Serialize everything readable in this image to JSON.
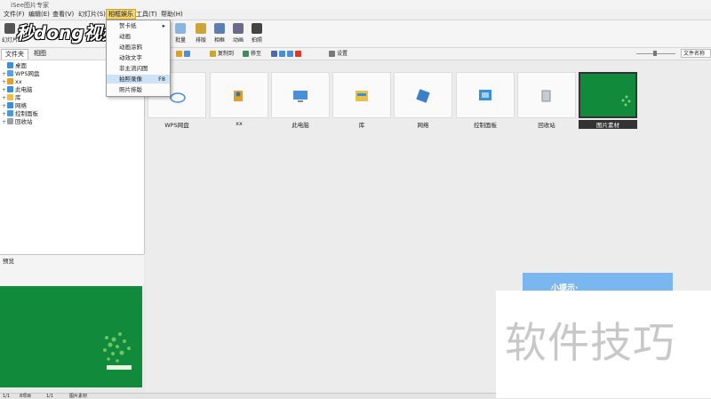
{
  "app": {
    "title": "iSee图片专家"
  },
  "menubar": [
    "文件(F)",
    "编辑(E)",
    "查看(V)",
    "幻灯片(S)",
    "相框娱乐",
    "工具(T)",
    "帮助(H)"
  ],
  "toolbar": {
    "left_label": "幻灯片",
    "items": [
      "批量",
      "排版",
      "相框",
      "动画",
      "拍照"
    ]
  },
  "logo": {
    "text": "秒dong视频"
  },
  "tabs": [
    "文件夹",
    "相图"
  ],
  "subtoolbar": {
    "items": [
      "复制到",
      "移至",
      "设置"
    ]
  },
  "search": {
    "placeholder": "文件名称"
  },
  "tree": [
    {
      "label": "桌面",
      "expander": "",
      "color": "#3a8fd8"
    },
    {
      "label": "WPS网盘",
      "expander": "+",
      "color": "#5aa0e0"
    },
    {
      "label": "xx",
      "expander": "+",
      "color": "#e0a030"
    },
    {
      "label": "此电脑",
      "expander": "+",
      "color": "#3a8fd8"
    },
    {
      "label": "库",
      "expander": "+",
      "color": "#e8c04a"
    },
    {
      "label": "网络",
      "expander": "+",
      "color": "#3a8fd8"
    },
    {
      "label": "控制面板",
      "expander": "+",
      "color": "#4a9ad8"
    },
    {
      "label": "回收站",
      "expander": "+",
      "color": "#9aa0a8"
    }
  ],
  "preview": {
    "label": "预览"
  },
  "thumbnails": [
    {
      "label": "WPS网盘",
      "icon": "cloud-icon",
      "color": "#4a90d9"
    },
    {
      "label": "xx",
      "icon": "user-icon",
      "color": "#d9a030"
    },
    {
      "label": "此电脑",
      "icon": "computer-icon",
      "color": "#4a90d9"
    },
    {
      "label": "库",
      "icon": "library-icon",
      "color": "#e8c04a"
    },
    {
      "label": "网络",
      "icon": "network-icon",
      "color": "#3a7fc8"
    },
    {
      "label": "控制面板",
      "icon": "control-panel-icon",
      "color": "#3a8fd8"
    },
    {
      "label": "回收站",
      "icon": "recycle-bin-icon",
      "color": "#9aa0a8"
    },
    {
      "label": "图片素材",
      "icon": "image-icon",
      "color": "#128a3b"
    }
  ],
  "dropdown": {
    "items": [
      {
        "label": "贺卡纸",
        "shortcut": ""
      },
      {
        "label": "动画",
        "shortcut": ""
      },
      {
        "label": "动画涂鸦",
        "shortcut": ""
      },
      {
        "label": "动效文字",
        "shortcut": ""
      },
      {
        "label": "非主流闪图",
        "shortcut": ""
      },
      {
        "label": "拍照录像",
        "shortcut": "F8"
      },
      {
        "label": "照片排版",
        "shortcut": ""
      }
    ]
  },
  "tip": {
    "text": "小提示·"
  },
  "watermark": {
    "text": "软件技巧"
  },
  "statusbar": [
    "1/1",
    "8项目",
    "1/1",
    "图片素材"
  ],
  "colors": {
    "accent": "#f5d56e",
    "highlight": "#cfe3f7",
    "green": "#128a3b"
  }
}
